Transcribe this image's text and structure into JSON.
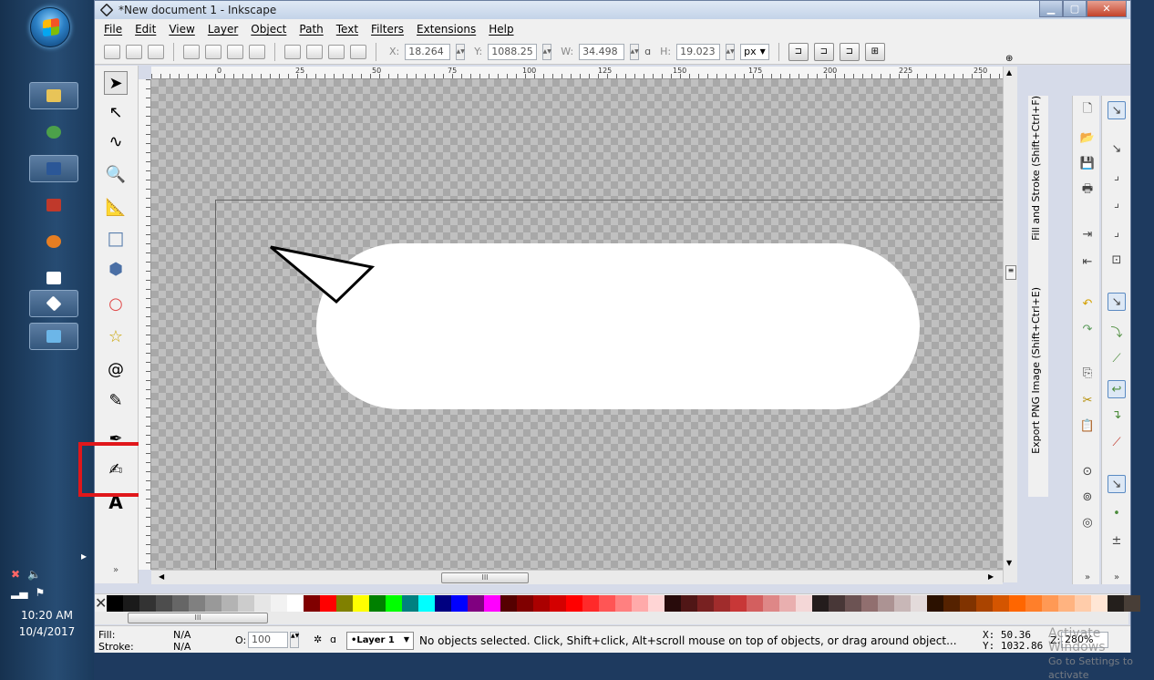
{
  "window": {
    "title": "*New document 1 - Inkscape"
  },
  "menu": [
    "File",
    "Edit",
    "View",
    "Layer",
    "Object",
    "Path",
    "Text",
    "Filters",
    "Extensions",
    "Help"
  ],
  "toolbar": {
    "x_label": "X:",
    "x_value": "18.264",
    "y_label": "Y:",
    "y_value": "1088.25",
    "w_label": "W:",
    "w_value": "34.498",
    "h_label": "H:",
    "h_value": "19.023",
    "unit": "px"
  },
  "ruler_labels": [
    "0",
    "25",
    "50",
    "75",
    "100",
    "125",
    "150",
    "175",
    "200",
    "225",
    "250"
  ],
  "dock": {
    "tab1": "Fill and Stroke (Shift+Ctrl+F)",
    "tab2": "Export PNG Image (Shift+Ctrl+E)"
  },
  "status": {
    "fill_label": "Fill:",
    "fill_value": "N/A",
    "stroke_label": "Stroke:",
    "stroke_value": "N/A",
    "opacity_label": "O:",
    "opacity_value": "100",
    "layer": "•Layer 1",
    "message": "No objects selected. Click, Shift+click, Alt+scroll mouse on top of objects, or drag around object...",
    "x_coord": "X:   50.36",
    "y_coord": "Y: 1032.86",
    "zoom_label": "Z:",
    "zoom_value": "280%"
  },
  "taskbar": {
    "time": "10:20 AM",
    "date": "10/4/2017"
  },
  "watermark": {
    "line1": "Activate Windows",
    "line2": "Go to Settings to activate"
  },
  "palette_colors": [
    "#000000",
    "#1a1a1a",
    "#333333",
    "#4d4d4d",
    "#666666",
    "#808080",
    "#999999",
    "#b3b3b3",
    "#cccccc",
    "#e6e6e6",
    "#f2f2f2",
    "#ffffff",
    "#800000",
    "#ff0000",
    "#808000",
    "#ffff00",
    "#008000",
    "#00ff00",
    "#008080",
    "#00ffff",
    "#000080",
    "#0000ff",
    "#800080",
    "#ff00ff",
    "#550000",
    "#800000",
    "#aa0000",
    "#d40000",
    "#ff0000",
    "#ff2a2a",
    "#ff5555",
    "#ff8080",
    "#ffaaaa",
    "#ffd5d5",
    "#280b0b",
    "#501616",
    "#782121",
    "#a02c2c",
    "#c83737",
    "#d35f5f",
    "#de8787",
    "#e9afaf",
    "#f4d7d7",
    "#241c1c",
    "#483737",
    "#6c5353",
    "#916f6f",
    "#ac9393",
    "#c8b7b7",
    "#e3dbdb",
    "#2b1100",
    "#552200",
    "#803300",
    "#aa4400",
    "#d45500",
    "#ff6600",
    "#ff7f2a",
    "#ff9955",
    "#ffb380",
    "#ffccaa",
    "#ffe6d5",
    "#241f1c",
    "#483e37"
  ],
  "colors": {
    "highlight": "#e0171b",
    "canvas_check": "#c0c0c0"
  }
}
